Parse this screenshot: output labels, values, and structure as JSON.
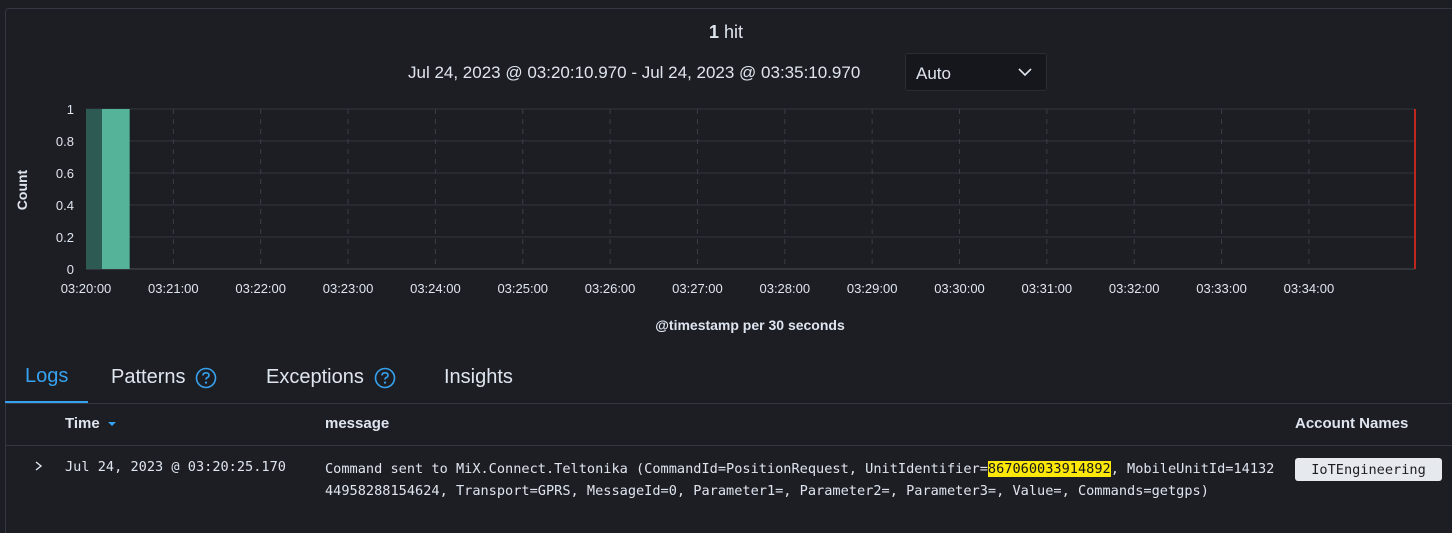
{
  "summary": {
    "hit_count": "1",
    "hit_label": "hit"
  },
  "time_range": {
    "text": "Jul 24, 2023 @ 03:20:10.970 - Jul 24, 2023 @ 03:35:10.970",
    "interval_value": "Auto"
  },
  "chart_data": {
    "type": "bar",
    "y_label": "Count",
    "x_label": "@timestamp per 30 seconds",
    "ylim": [
      0,
      1
    ],
    "y_ticks": [
      "0",
      "0.2",
      "0.4",
      "0.6",
      "0.8",
      "1"
    ],
    "x_ticks": [
      "03:20:00",
      "03:21:00",
      "03:22:00",
      "03:23:00",
      "03:24:00",
      "03:25:00",
      "03:26:00",
      "03:27:00",
      "03:28:00",
      "03:29:00",
      "03:30:00",
      "03:31:00",
      "03:32:00",
      "03:33:00",
      "03:34:00"
    ],
    "range_start": "03:20:10.970",
    "range_end": "03:35:10.970",
    "bars": [
      {
        "start": "03:20:00",
        "end": "03:20:30",
        "value": 1
      }
    ],
    "bar_color": "#54b399",
    "end_marker_color": "#bd271e"
  },
  "tabs": [
    {
      "label": "Logs",
      "active": true,
      "help": false
    },
    {
      "label": "Patterns",
      "active": false,
      "help": true
    },
    {
      "label": "Exceptions",
      "active": false,
      "help": true
    },
    {
      "label": "Insights",
      "active": false,
      "help": false
    }
  ],
  "table": {
    "columns": {
      "time": "Time",
      "message": "message",
      "account": "Account Names"
    },
    "sort_indicator": "descending",
    "rows": [
      {
        "time": "Jul 24, 2023 @ 03:20:25.170",
        "message_pre": "Command sent to MiX.Connect.Teltonika (CommandId=PositionRequest, UnitIdentifier=",
        "message_highlight": "867060033914892",
        "message_post": ", MobileUnitId=1413244958288154624, Transport=GPRS, MessageId=0, Parameter1=, Parameter2=, Parameter3=, Value=, Commands=getgps)",
        "account": "IoTEngineering"
      }
    ]
  },
  "colors": {
    "accent": "#36a2ef",
    "highlight": "#fde80a",
    "background": "#1d1e24"
  }
}
